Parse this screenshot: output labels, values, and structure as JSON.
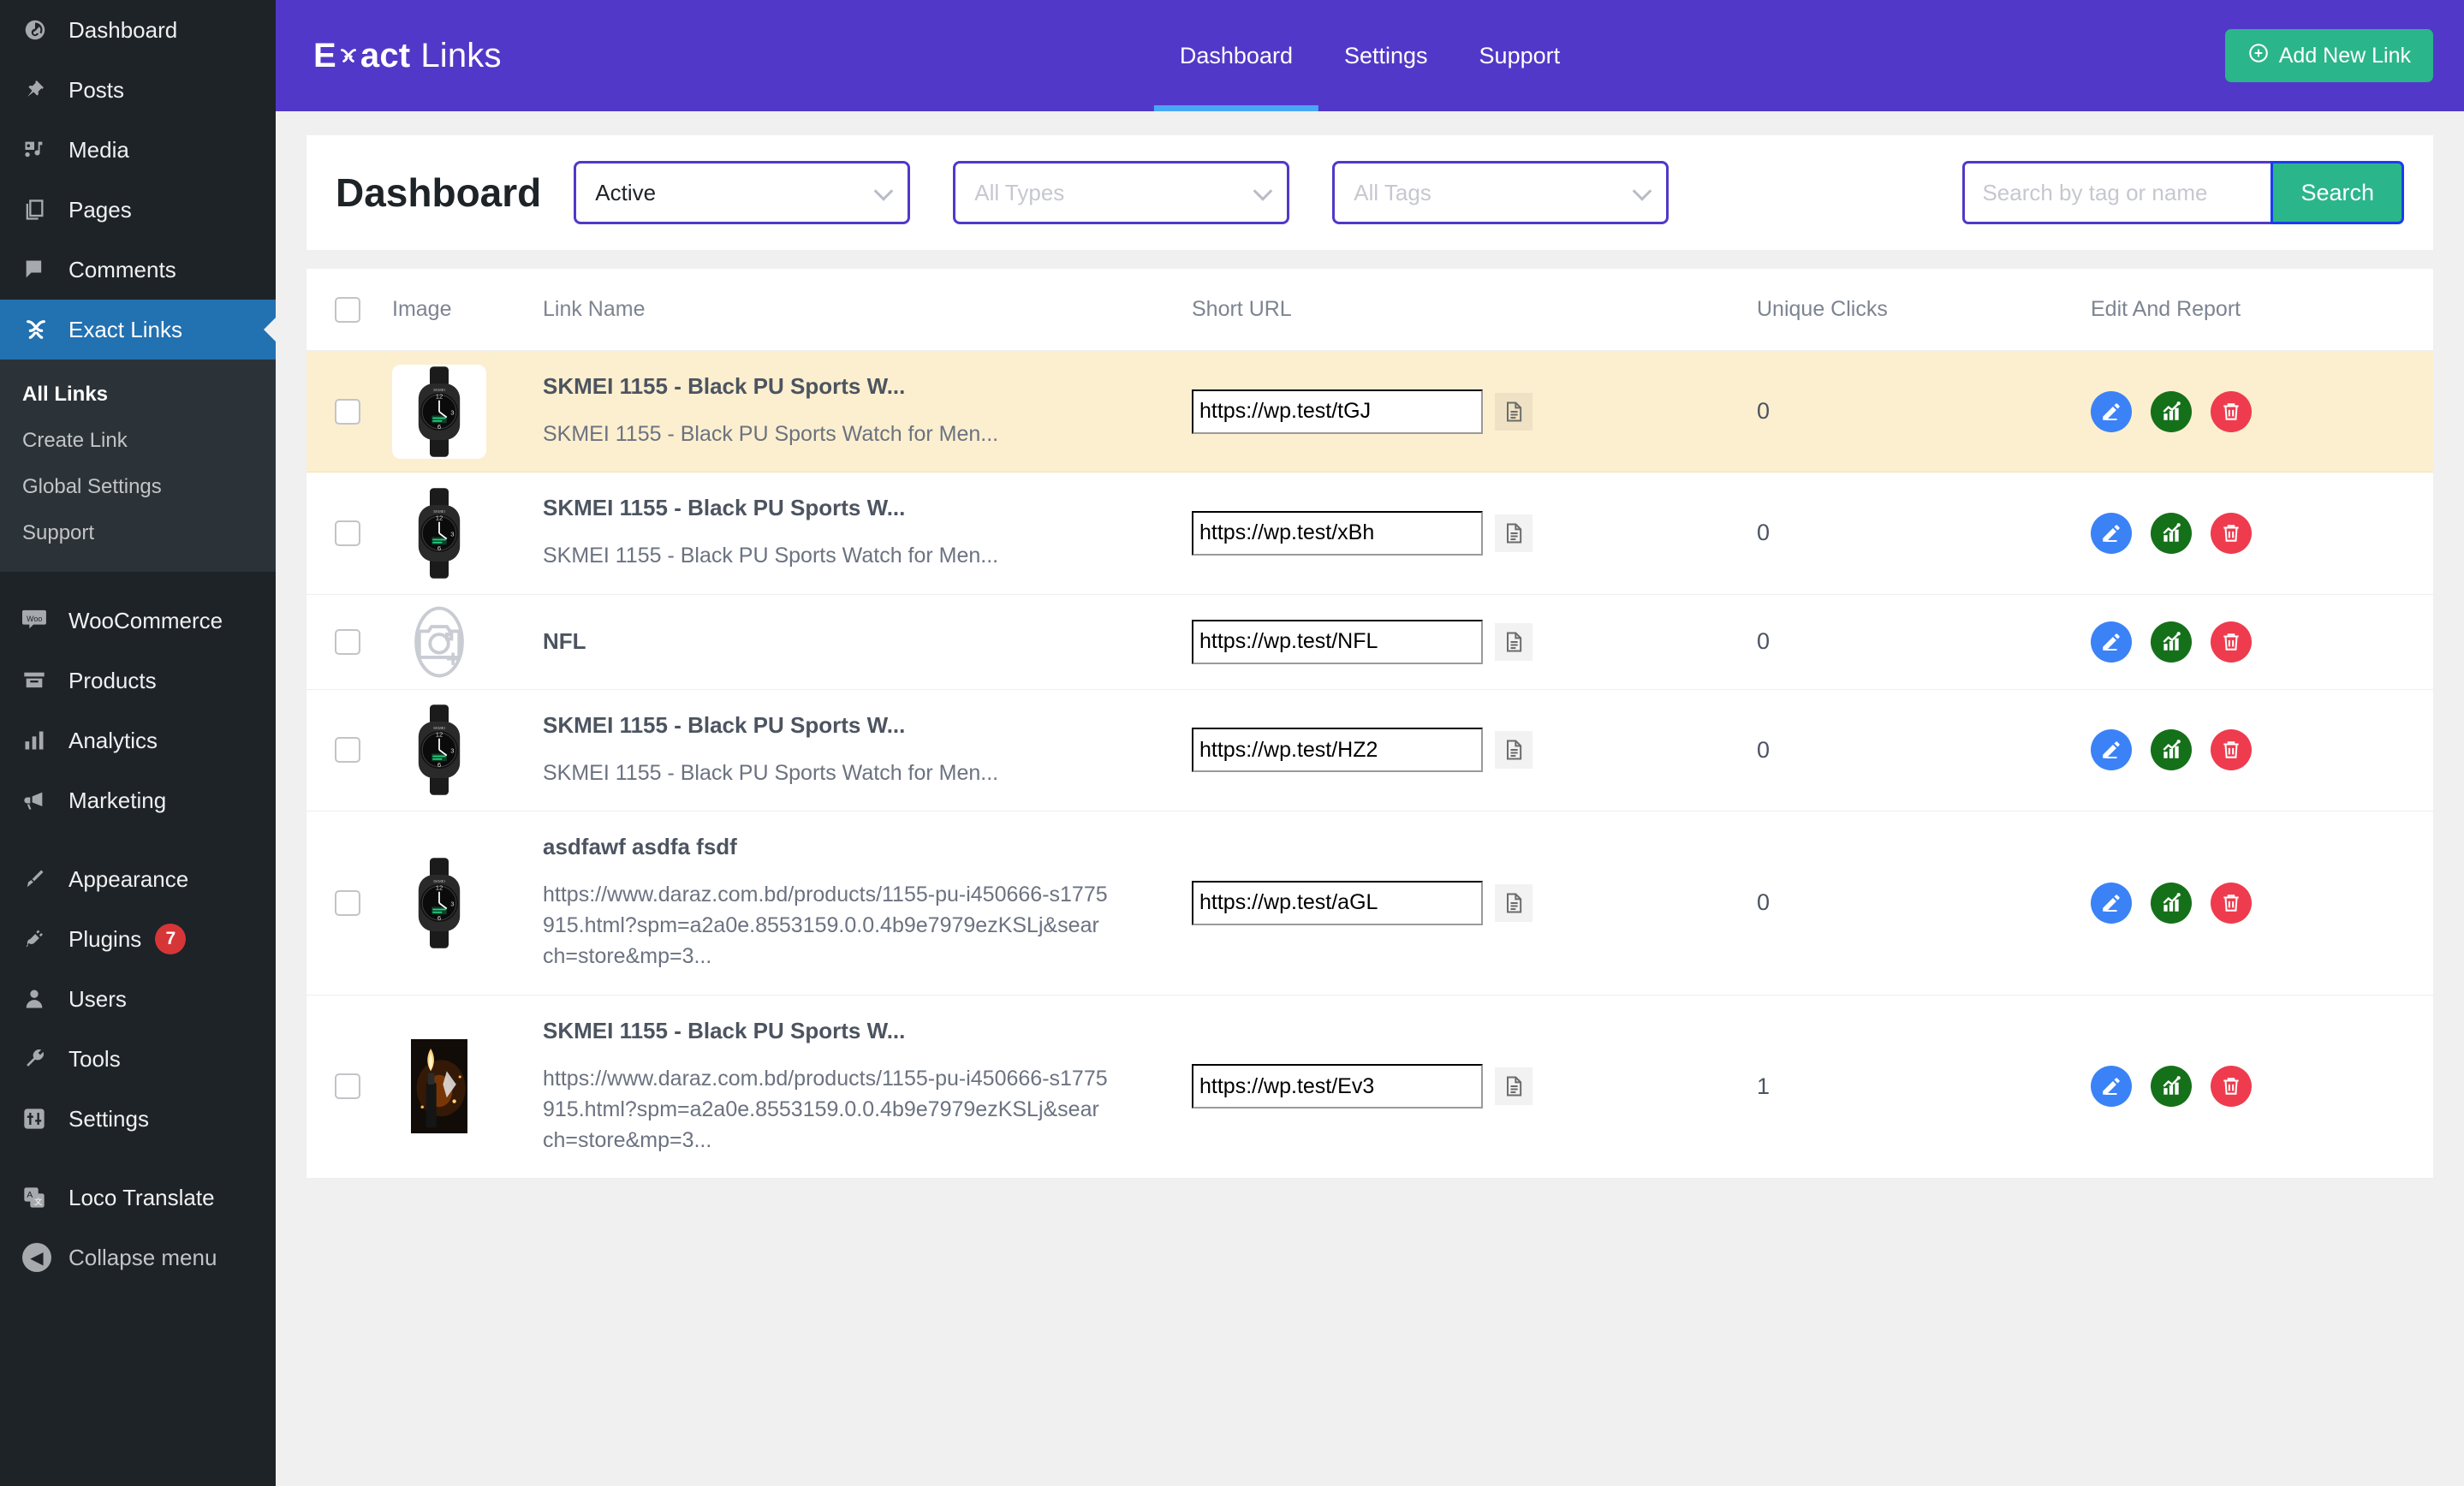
{
  "wp_sidebar": {
    "items": [
      {
        "label": "Dashboard",
        "icon": "dashboard-icon"
      },
      {
        "label": "Posts",
        "icon": "pin-icon"
      },
      {
        "label": "Media",
        "icon": "media-icon"
      },
      {
        "label": "Pages",
        "icon": "pages-icon"
      },
      {
        "label": "Comments",
        "icon": "comment-icon"
      }
    ],
    "active_item": {
      "label": "Exact Links",
      "icon": "exact-links-icon"
    },
    "submenu": [
      {
        "label": "All Links",
        "current": true
      },
      {
        "label": "Create Link",
        "current": false
      },
      {
        "label": "Global Settings",
        "current": false
      },
      {
        "label": "Support",
        "current": false
      }
    ],
    "items2": [
      {
        "label": "WooCommerce",
        "icon": "woo-icon"
      },
      {
        "label": "Products",
        "icon": "products-icon"
      },
      {
        "label": "Analytics",
        "icon": "analytics-icon"
      },
      {
        "label": "Marketing",
        "icon": "marketing-icon"
      }
    ],
    "items3": [
      {
        "label": "Appearance",
        "icon": "brush-icon"
      },
      {
        "label": "Plugins",
        "icon": "plug-icon",
        "badge": "7"
      },
      {
        "label": "Users",
        "icon": "user-icon"
      },
      {
        "label": "Tools",
        "icon": "wrench-icon"
      },
      {
        "label": "Settings",
        "icon": "settings-icon"
      }
    ],
    "items4": [
      {
        "label": "Loco Translate",
        "icon": "translate-icon"
      }
    ],
    "collapse": {
      "label": "Collapse menu",
      "icon": "collapse-arrow-icon"
    }
  },
  "topbar": {
    "logo_prefix": "E",
    "logo_mid": "act",
    "logo_suffix": "Links",
    "logo_icon": "exact-x-icon",
    "nav": [
      {
        "label": "Dashboard",
        "active": true
      },
      {
        "label": "Settings",
        "active": false
      },
      {
        "label": "Support",
        "active": false
      }
    ],
    "add_button": "Add New Link",
    "add_icon": "plus-circle-icon",
    "bg_color": "#5238c8",
    "accent_color": "#49a7f5",
    "green_color": "#2bb58a"
  },
  "filters": {
    "page_title": "Dashboard",
    "status_select": {
      "value": "Active",
      "placeholder": ""
    },
    "type_select": {
      "value": "",
      "placeholder": "All Types"
    },
    "tag_select": {
      "value": "",
      "placeholder": "All Tags"
    },
    "search": {
      "value": "",
      "placeholder": "Search by tag or name",
      "button": "Search"
    }
  },
  "table": {
    "columns": [
      "Image",
      "Link Name",
      "Short URL",
      "Unique Clicks",
      "Edit And Report"
    ],
    "rows": [
      {
        "highlighted": true,
        "image": "watch-thumb",
        "name": "SKMEI 1155 - Black PU Sports W...",
        "sub": "SKMEI 1155 - Black PU Sports Watch for Men...",
        "short_url": "https://wp.test/tGJ",
        "clicks": "0"
      },
      {
        "highlighted": false,
        "image": "watch-thumb",
        "name": "SKMEI 1155 - Black PU Sports W...",
        "sub": "SKMEI 1155 - Black PU Sports Watch for Men...",
        "short_url": "https://wp.test/xBh",
        "clicks": "0"
      },
      {
        "highlighted": false,
        "image": "camera-placeholder",
        "name": "NFL",
        "sub": "",
        "short_url": "https://wp.test/NFL",
        "clicks": "0"
      },
      {
        "highlighted": false,
        "image": "watch-thumb",
        "name": "SKMEI 1155 - Black PU Sports W...",
        "sub": "SKMEI 1155 - Black PU Sports Watch for Men...",
        "short_url": "https://wp.test/HZ2",
        "clicks": "0"
      },
      {
        "highlighted": false,
        "image": "watch-thumb",
        "name": "asdfawf asdfa fsdf",
        "sub": "https://www.daraz.com.bd/products/1155-pu-i450666-s1775915.html?spm=a2a0e.8553159.0.0.4b9e7979ezKSLj&search=store&mp=3...",
        "short_url": "https://wp.test/aGL",
        "clicks": "0"
      },
      {
        "highlighted": false,
        "image": "lighter-thumb",
        "name": "SKMEI 1155 - Black PU Sports W...",
        "sub": "https://www.daraz.com.bd/products/1155-pu-i450666-s1775915.html?spm=a2a0e.8553159.0.0.4b9e7979ezKSLj&search=store&mp=3...",
        "short_url": "https://wp.test/Ev3",
        "clicks": "1"
      }
    ],
    "row_actions": {
      "edit": "edit-pencil-icon",
      "report": "report-chart-icon",
      "delete": "delete-trash-icon",
      "copy": "copy-document-icon"
    },
    "highlight_color": "#fcefcf"
  }
}
